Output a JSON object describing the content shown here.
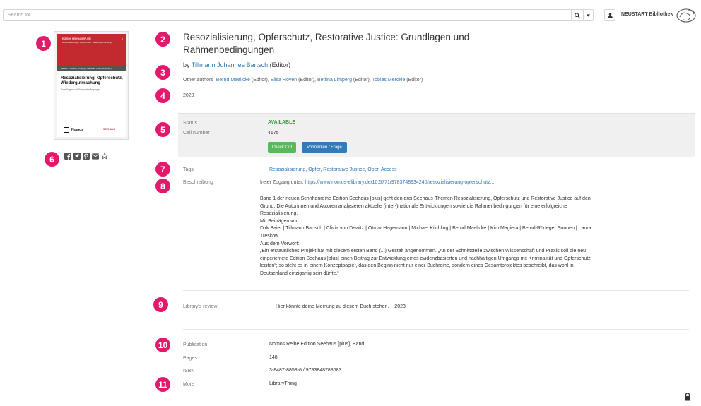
{
  "topbar": {
    "search_placeholder": "Search for...",
    "library_name": "NEUSTART Bibliothek",
    "icons": [
      "search-icon",
      "caret-down-icon",
      "user-icon",
      "library-logo"
    ]
  },
  "markers": [
    "1",
    "2",
    "3",
    "4",
    "5",
    "6",
    "7",
    "8",
    "9",
    "10",
    "11"
  ],
  "cover": {
    "series": "EDITION SEEHAUS [PLUS]",
    "number": "1",
    "tagline": "Resozialisierung · Opferschutz · Wiedergutmachung",
    "authors": "Bartsch | Hoven | Limperg | Maelicke | Merckle (Hrsg.)",
    "title": "Resozialisierung, Opferschutz, Wiedergutmachung",
    "subtitle": "Grundlagen und Rahmenbedingungen",
    "publisher": "Nomos",
    "partner": "SEEHAUS"
  },
  "share_icons": [
    "facebook-icon",
    "twitter-icon",
    "pinterest-icon",
    "email-icon",
    "star-icon"
  ],
  "book": {
    "title": "Resozialisierung, Opferschutz, Restorative Justice: Grundlagen und Rahmenbedingungen",
    "by_prefix": "by",
    "main_author": "Tillmann Johannes Bartsch",
    "main_author_role": "(Editor)",
    "other_authors_label": "Other authors",
    "other_authors": [
      {
        "name": "Bernd Maelicke",
        "role": "(Editor),"
      },
      {
        "name": "Elisa Hoven",
        "role": "(Editor),"
      },
      {
        "name": "Bettina Limperg",
        "role": "(Editor),"
      },
      {
        "name": "Tobias Merckle",
        "role": "(Editor)"
      }
    ],
    "year": "2023"
  },
  "holding": {
    "status_label": "Status",
    "status_value": "AVAILABLE",
    "call_number_label": "Call number",
    "call_number_value": "4175",
    "checkout_button": "Check Out",
    "reserve_button": "Vormerken / Frage"
  },
  "details": {
    "tags_label": "Tags",
    "tags_value": "Resozialisierung, Opfer, Restorative Justice, Open Access",
    "description_label": "Beschreibung",
    "free_access_prefix": "freier Zugang unter:",
    "free_access_link": "https://www.nomos-elibrary.de/10.5771/9783748934240/resozialisierung-opferschutz...",
    "description_paragraphs": [
      "Band 1 der neuen Schriftenreihe Edition Seehaus [plus] geht den drei Seehaus-Themen Resozialisierung, Opferschutz und Restorative Justice auf den Grund. Die Autorinnen und Autoren analysieren aktuelle (inter-)nationale Entwicklungen sowie die Rahmenbedingungen für eine erfolgreiche Resozialisierung.",
      "Mit Beiträgen von",
      "Dirk Baier | Tillmann Bartsch | Clivia von Dewitz | Otmar Hagemann | Michael Kilchling | Bernd Maelicke | Kim Magiera | Bernd-Rüdeger Sonnen | Laura Treskow",
      "Aus dem Vorwort:",
      "„Ein erstaunliches Projekt hat mit diesem ersten Band (...) Gestalt angenommen. „An der Schnittstelle zwischen Wissenschaft und Praxis soll die neu eingerichtete Edition Seehaus [plus] einen Beitrag zur Entwicklung eines evidenzbasierten und nachhaltigen Umgangs mit Kriminalität und Opferschutz leisten“; so steht es in einem Konzeptpapier, das den Beginn nicht nur einer Buchreihe, sondern eines Gesamtprojektes beschreibt, das wohl in Deutschland einzigartig sein dürfte.“"
    ],
    "review_label": "Library's review",
    "review_text": "Hier könnte deine Meinung zu diesem Buch stehen. ~ 2023",
    "publication_label": "Publication",
    "publication_value": "Nomos Reihe Edition Seehaus [plus], Band 1",
    "pages_label": "Pages",
    "pages_value": "148",
    "isbn_label": "ISBN",
    "isbn_value": "3-8487-8858-6 / 9783848788583",
    "more_label": "More",
    "more_value": "LibraryThing"
  },
  "colors": {
    "marker": "#e5196b",
    "link": "#337ab7",
    "available": "#3c9a3c",
    "checkout": "#5cb85c",
    "reserve": "#337ab7",
    "cover_red": "#c32a2f"
  }
}
